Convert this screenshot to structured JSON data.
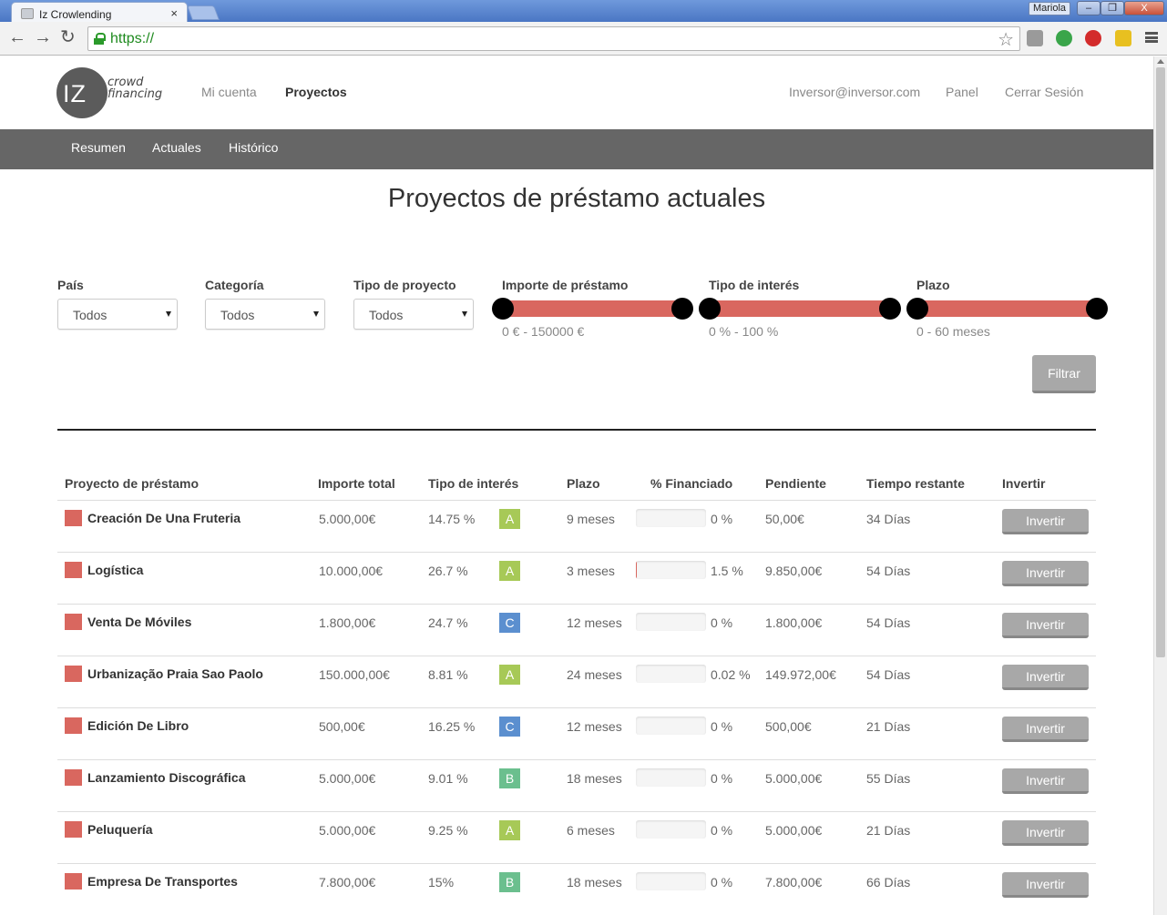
{
  "browser": {
    "tab_title": "Iz Crowlending",
    "tab_close": "×",
    "user": "Mariola",
    "url": "https://",
    "window_buttons": [
      "–",
      "❐",
      "X"
    ]
  },
  "header": {
    "logo_letters": "IZ",
    "logo_word1": "crowd",
    "logo_word2": "financing",
    "nav": [
      {
        "label": "Mi cuenta",
        "active": false
      },
      {
        "label": "Proyectos",
        "active": true
      }
    ],
    "user_email": "Inversor@inversor.com",
    "panel": "Panel",
    "logout": "Cerrar Sesión"
  },
  "subnav": [
    "Resumen",
    "Actuales",
    "Histórico"
  ],
  "page_title": "Proyectos de préstamo actuales",
  "filters": {
    "pais": {
      "label": "País",
      "value": "Todos"
    },
    "categoria": {
      "label": "Categoría",
      "value": "Todos"
    },
    "tipo_proyecto": {
      "label": "Tipo de proyecto",
      "value": "Todos"
    },
    "importe": {
      "label": "Importe de préstamo",
      "range": "0 € - 150000 €",
      "min": 0,
      "max": 150000
    },
    "interes": {
      "label": "Tipo de interés",
      "range": "0 % - 100 %",
      "min": 0,
      "max": 100
    },
    "plazo": {
      "label": "Plazo",
      "range": "0 - 60 meses",
      "min": 0,
      "max": 60
    },
    "button": "Filtrar"
  },
  "table": {
    "headers": [
      "Proyecto de préstamo",
      "Importe total",
      "Tipo de interés",
      "Plazo",
      "% Financiado",
      "Pendiente",
      "Tiempo restante",
      "Invertir"
    ],
    "rows": [
      {
        "name": "Creación De Una Fruteria",
        "importe": "5.000,00€",
        "interes": "14.75 %",
        "grade": "A",
        "plazo": "9 meses",
        "financiado": "0 %",
        "pct": 0,
        "pendiente": "50,00€",
        "tiempo": "34 Días",
        "action": "Invertir"
      },
      {
        "name": "Logística",
        "importe": "10.000,00€",
        "interes": "26.7 %",
        "grade": "A",
        "plazo": "3 meses",
        "financiado": "1.5 %",
        "pct": 1.5,
        "pendiente": "9.850,00€",
        "tiempo": "54 Días",
        "action": "Invertir"
      },
      {
        "name": "Venta De Móviles",
        "importe": "1.800,00€",
        "interes": "24.7 %",
        "grade": "C",
        "plazo": "12 meses",
        "financiado": "0 %",
        "pct": 0,
        "pendiente": "1.800,00€",
        "tiempo": "54 Días",
        "action": "Invertir"
      },
      {
        "name": "Urbanização Praia Sao Paolo",
        "importe": "150.000,00€",
        "interes": "8.81 %",
        "grade": "A",
        "plazo": "24 meses",
        "financiado": "0.02 %",
        "pct": 0.02,
        "pendiente": "149.972,00€",
        "tiempo": "54 Días",
        "action": "Invertir"
      },
      {
        "name": "Edición De Libro",
        "importe": "500,00€",
        "interes": "16.25 %",
        "grade": "C",
        "plazo": "12 meses",
        "financiado": "0 %",
        "pct": 0,
        "pendiente": "500,00€",
        "tiempo": "21 Días",
        "action": "Invertir"
      },
      {
        "name": "Lanzamiento Discográfica",
        "importe": "5.000,00€",
        "interes": "9.01 %",
        "grade": "B",
        "plazo": "18 meses",
        "financiado": "0 %",
        "pct": 0,
        "pendiente": "5.000,00€",
        "tiempo": "55 Días",
        "action": "Invertir"
      },
      {
        "name": "Peluquería",
        "importe": "5.000,00€",
        "interes": "9.25 %",
        "grade": "A",
        "plazo": "6 meses",
        "financiado": "0 %",
        "pct": 0,
        "pendiente": "5.000,00€",
        "tiempo": "21 Días",
        "action": "Invertir"
      },
      {
        "name": "Empresa De Transportes",
        "importe": "7.800,00€",
        "interes": "15%",
        "grade": "B",
        "plazo": "18 meses",
        "financiado": "0 %",
        "pct": 0,
        "pendiente": "7.800,00€",
        "tiempo": "66 Días",
        "action": "Invertir"
      }
    ]
  },
  "colors": {
    "accent": "#d9675f",
    "grade_A": "#a7c957",
    "grade_B": "#6bbf8e",
    "grade_C": "#5b8fcf",
    "subnav_bg": "#666666"
  }
}
